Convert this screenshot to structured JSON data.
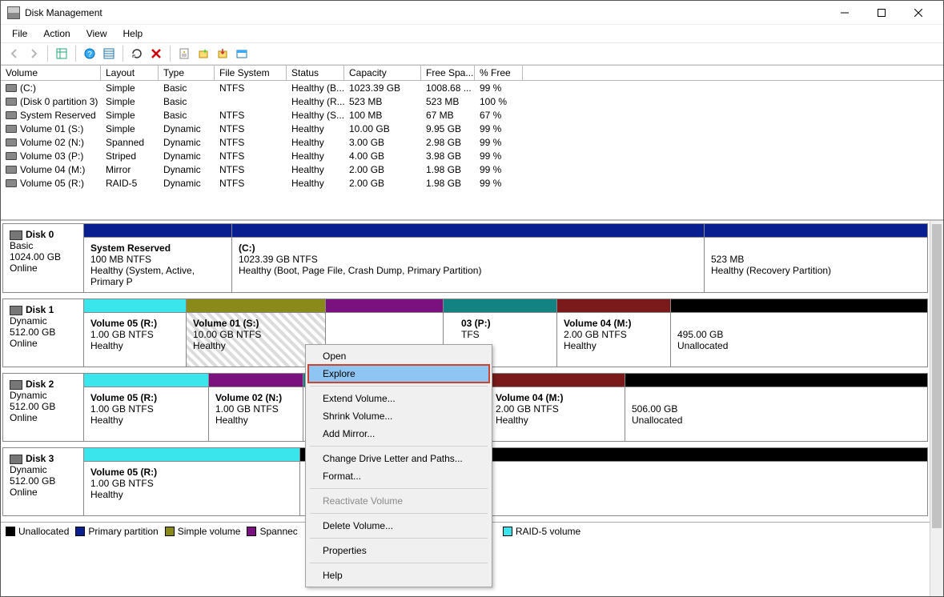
{
  "window": {
    "title": "Disk Management"
  },
  "menu": {
    "file": "File",
    "action": "Action",
    "view": "View",
    "help": "Help"
  },
  "columns": {
    "volume": "Volume",
    "layout": "Layout",
    "type": "Type",
    "fs": "File System",
    "status": "Status",
    "capacity": "Capacity",
    "free": "Free Spa...",
    "pct": "% Free"
  },
  "rows": [
    {
      "volume": "(C:)",
      "layout": "Simple",
      "type": "Basic",
      "fs": "NTFS",
      "status": "Healthy (B...",
      "cap": "1023.39 GB",
      "free": "1008.68 ...",
      "pct": "99 %"
    },
    {
      "volume": "(Disk 0 partition 3)",
      "layout": "Simple",
      "type": "Basic",
      "fs": "",
      "status": "Healthy (R...",
      "cap": "523 MB",
      "free": "523 MB",
      "pct": "100 %"
    },
    {
      "volume": "System Reserved",
      "layout": "Simple",
      "type": "Basic",
      "fs": "NTFS",
      "status": "Healthy (S...",
      "cap": "100 MB",
      "free": "67 MB",
      "pct": "67 %"
    },
    {
      "volume": "Volume 01 (S:)",
      "layout": "Simple",
      "type": "Dynamic",
      "fs": "NTFS",
      "status": "Healthy",
      "cap": "10.00 GB",
      "free": "9.95 GB",
      "pct": "99 %"
    },
    {
      "volume": "Volume 02 (N:)",
      "layout": "Spanned",
      "type": "Dynamic",
      "fs": "NTFS",
      "status": "Healthy",
      "cap": "3.00 GB",
      "free": "2.98 GB",
      "pct": "99 %"
    },
    {
      "volume": "Volume 03 (P:)",
      "layout": "Striped",
      "type": "Dynamic",
      "fs": "NTFS",
      "status": "Healthy",
      "cap": "4.00 GB",
      "free": "3.98 GB",
      "pct": "99 %"
    },
    {
      "volume": "Volume 04 (M:)",
      "layout": "Mirror",
      "type": "Dynamic",
      "fs": "NTFS",
      "status": "Healthy",
      "cap": "2.00 GB",
      "free": "1.98 GB",
      "pct": "99 %"
    },
    {
      "volume": "Volume 05 (R:)",
      "layout": "RAID-5",
      "type": "Dynamic",
      "fs": "NTFS",
      "status": "Healthy",
      "cap": "2.00 GB",
      "free": "1.98 GB",
      "pct": "99 %"
    }
  ],
  "disks": {
    "d0": {
      "name": "Disk 0",
      "kind": "Basic",
      "size": "1024.00 GB",
      "state": "Online",
      "p0": {
        "title": "System Reserved",
        "sub": "100 MB NTFS",
        "health": "Healthy (System, Active, Primary P"
      },
      "p1": {
        "title": "(C:)",
        "sub": "1023.39 GB NTFS",
        "health": "Healthy (Boot, Page File, Crash Dump, Primary Partition)"
      },
      "p2": {
        "title": "",
        "sub": "523 MB",
        "health": "Healthy (Recovery Partition)"
      }
    },
    "d1": {
      "name": "Disk 1",
      "kind": "Dynamic",
      "size": "512.00 GB",
      "state": "Online",
      "p0": {
        "title": "Volume 05  (R:)",
        "sub": "1.00 GB NTFS",
        "health": "Healthy"
      },
      "p1": {
        "title": "Volume 01  (S:)",
        "sub": "10.00 GB NTFS",
        "health": "Healthy"
      },
      "p2": {
        "title": "",
        "sub": "",
        "health": ""
      },
      "p3": {
        "title": "03  (P:)",
        "sub": "TFS",
        "health": ""
      },
      "p4": {
        "title": "Volume 04  (M:)",
        "sub": "2.00 GB NTFS",
        "health": "Healthy"
      },
      "p5": {
        "title": "",
        "sub": "495.00 GB",
        "health": "Unallocated"
      }
    },
    "d2": {
      "name": "Disk 2",
      "kind": "Dynamic",
      "size": "512.00 GB",
      "state": "Online",
      "p0": {
        "title": "Volume 05  (R:)",
        "sub": "1.00 GB NTFS",
        "health": "Healthy"
      },
      "p1": {
        "title": "Volume 02  (N:)",
        "sub": "1.00 GB NTFS",
        "health": "Healthy"
      },
      "p2": {
        "title": "",
        "sub": "",
        "health": ""
      },
      "p3": {
        "title": "Volume 04  (M:)",
        "sub": "2.00 GB NTFS",
        "health": "Healthy"
      },
      "p4": {
        "title": "",
        "sub": "506.00 GB",
        "health": "Unallocated"
      }
    },
    "d3": {
      "name": "Disk 3",
      "kind": "Dynamic",
      "size": "512.00 GB",
      "state": "Online",
      "p0": {
        "title": "Volume 05  (R:)",
        "sub": "1.00 GB NTFS",
        "health": "Healthy"
      },
      "p1": {
        "title": "",
        "sub": "",
        "health": ""
      }
    }
  },
  "ctx": {
    "open": "Open",
    "explore": "Explore",
    "extend": "Extend Volume...",
    "shrink": "Shrink Volume...",
    "addmirror": "Add Mirror...",
    "drive": "Change Drive Letter and Paths...",
    "format": "Format...",
    "react": "Reactivate Volume",
    "delete": "Delete Volume...",
    "props": "Properties",
    "help": "Help"
  },
  "legend": {
    "unalloc": "Unallocated",
    "primary": "Primary partition",
    "simple": "Simple volume",
    "spanned": "Spannec",
    "raid": "RAID-5 volume"
  }
}
